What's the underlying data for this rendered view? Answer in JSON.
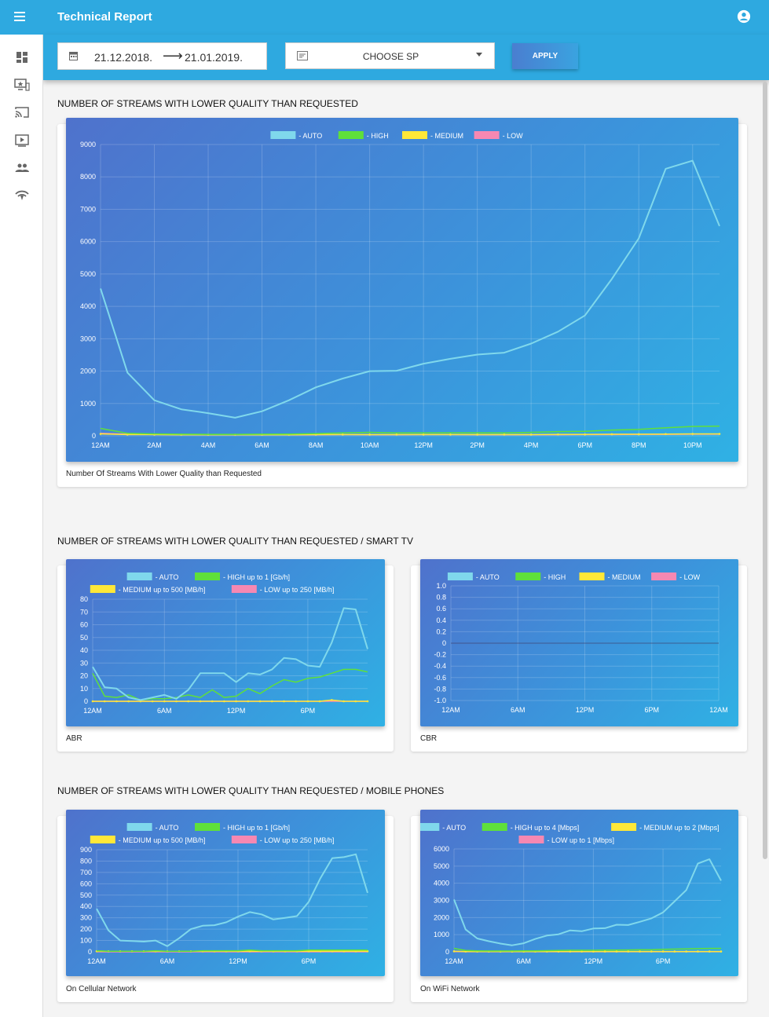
{
  "app": {
    "title": "Technical Report"
  },
  "filters": {
    "date_from": "21.12.2018.",
    "date_to": "21.01.2019.",
    "sp_label": "CHOOSE SP",
    "apply_label": "APPLY"
  },
  "sidebar": {
    "items": [
      {
        "icon": "dashboard-icon"
      },
      {
        "icon": "monitor-star-icon"
      },
      {
        "icon": "cast-icon"
      },
      {
        "icon": "play-screen-icon"
      },
      {
        "icon": "users-icon"
      },
      {
        "icon": "wifi-signal-icon"
      }
    ]
  },
  "sections": {
    "s1_title": "NUMBER OF STREAMS WITH LOWER QUALITY THAN REQUESTED",
    "s2_title": "NUMBER OF STREAMS WITH LOWER QUALITY THAN REQUESTED / SMART TV",
    "s3_title": "NUMBER OF STREAMS WITH LOWER QUALITY THAN REQUESTED / MOBILE PHONES"
  },
  "colors": {
    "auto": "#7fd8ec",
    "high": "#5fe03a",
    "medium": "#ffe838",
    "low": "#f688b2"
  },
  "chart_data": [
    {
      "id": "main",
      "type": "line",
      "caption": "Number Of Streams With Lower Quality than Requested",
      "ylim": [
        0,
        9000
      ],
      "yticks": [
        0,
        1000,
        2000,
        3000,
        4000,
        5000,
        6000,
        7000,
        8000,
        9000
      ],
      "xlim": [
        0,
        23
      ],
      "xticks": [
        {
          "x": 0,
          "label": "12AM"
        },
        {
          "x": 2,
          "label": "2AM"
        },
        {
          "x": 4,
          "label": "4AM"
        },
        {
          "x": 6,
          "label": "6AM"
        },
        {
          "x": 8,
          "label": "8AM"
        },
        {
          "x": 10,
          "label": "10AM"
        },
        {
          "x": 12,
          "label": "12PM"
        },
        {
          "x": 14,
          "label": "2PM"
        },
        {
          "x": 16,
          "label": "4PM"
        },
        {
          "x": 18,
          "label": "6PM"
        },
        {
          "x": 20,
          "label": "8PM"
        },
        {
          "x": 22,
          "label": "10PM"
        }
      ],
      "legend_rows": [
        [
          "auto",
          "high",
          "medium",
          "low"
        ]
      ],
      "series": [
        {
          "key": "auto",
          "name": "-  AUTO",
          "values": [
            4550,
            1950,
            1100,
            820,
            700,
            560,
            760,
            1100,
            1500,
            1770,
            2000,
            2010,
            2230,
            2380,
            2510,
            2570,
            2850,
            3220,
            3720,
            4850,
            6100,
            8250,
            8500,
            6480
          ]
        },
        {
          "key": "high",
          "name": "- HIGH",
          "values": [
            230,
            80,
            60,
            50,
            45,
            45,
            50,
            55,
            70,
            90,
            110,
            90,
            90,
            95,
            95,
            90,
            110,
            130,
            140,
            180,
            200,
            250,
            290,
            300
          ]
        },
        {
          "key": "medium",
          "name": "- MEDIUM",
          "values": [
            60,
            40,
            40,
            35,
            35,
            35,
            35,
            35,
            40,
            40,
            40,
            40,
            40,
            40,
            40,
            40,
            40,
            45,
            45,
            50,
            50,
            55,
            60,
            60
          ]
        },
        {
          "key": "low",
          "name": "- LOW",
          "values": [
            80,
            50,
            40,
            35,
            30,
            30,
            30,
            30,
            35,
            40,
            35,
            35,
            40,
            40,
            35,
            35,
            35,
            35,
            40,
            40,
            45,
            45,
            50,
            50
          ]
        }
      ]
    },
    {
      "id": "abr",
      "type": "line",
      "caption": "ABR",
      "ylim": [
        0,
        80
      ],
      "yticks": [
        0,
        10,
        20,
        30,
        40,
        50,
        60,
        70,
        80
      ],
      "xlim": [
        0,
        23
      ],
      "xticks": [
        {
          "x": 0,
          "label": "12AM"
        },
        {
          "x": 6,
          "label": "6AM"
        },
        {
          "x": 12,
          "label": "12PM"
        },
        {
          "x": 18,
          "label": "6PM"
        }
      ],
      "legend_rows": [
        [
          "auto",
          "high"
        ],
        [
          "medium",
          "low"
        ]
      ],
      "series": [
        {
          "key": "auto",
          "name": "-  AUTO",
          "values": [
            27,
            11,
            10,
            3,
            1,
            3,
            5,
            2,
            9,
            22,
            22,
            22,
            15,
            22,
            21,
            25,
            34,
            33,
            28,
            27,
            46,
            73,
            72,
            41
          ]
        },
        {
          "key": "high",
          "name": "- HIGH  up to 1 [Gb/h]",
          "values": [
            22,
            4,
            3,
            5,
            1,
            2,
            2,
            3,
            5,
            3,
            9,
            3,
            4,
            10,
            6,
            12,
            17,
            15,
            18,
            19,
            22,
            25,
            25,
            23
          ]
        },
        {
          "key": "medium",
          "name": "- MEDIUM up to 500 [MB/h]",
          "values": [
            0,
            0,
            0,
            0,
            0,
            0,
            0,
            0,
            0,
            0,
            0,
            0,
            0,
            0,
            0,
            0,
            0,
            0,
            0,
            0,
            1,
            0,
            0,
            0
          ]
        },
        {
          "key": "low",
          "name": "- LOW up to 250 [MB/h]",
          "values": [
            0,
            0,
            0,
            0,
            0,
            0,
            0,
            0,
            0,
            0,
            0,
            0,
            0,
            0,
            0,
            0,
            0,
            0,
            0,
            0,
            0,
            0,
            0,
            0
          ]
        }
      ]
    },
    {
      "id": "cbr",
      "type": "line",
      "caption": "CBR",
      "ylim": [
        -1.0,
        1.0
      ],
      "yticks": [
        -1.0,
        -0.8,
        -0.6,
        -0.4,
        -0.2,
        0,
        0.2,
        0.4,
        0.6,
        0.8,
        1.0
      ],
      "ytick_labels": [
        "-1.0",
        "-0.8",
        "-0.6",
        "-0.4",
        "-0.2",
        "0",
        "0.2",
        "0.4",
        "0.6",
        "0.8",
        "1.0"
      ],
      "xlim": [
        0,
        24
      ],
      "xticks": [
        {
          "x": 0,
          "label": "12AM"
        },
        {
          "x": 6,
          "label": "6AM"
        },
        {
          "x": 12,
          "label": "12PM"
        },
        {
          "x": 18,
          "label": "6PM"
        },
        {
          "x": 24,
          "label": "12AM"
        }
      ],
      "legend_rows": [
        [
          "auto",
          "high",
          "medium",
          "low"
        ]
      ],
      "zero_line": true,
      "series": [
        {
          "key": "auto",
          "name": "-  AUTO",
          "values": []
        },
        {
          "key": "high",
          "name": "- HIGH",
          "values": []
        },
        {
          "key": "medium",
          "name": "- MEDIUM",
          "values": []
        },
        {
          "key": "low",
          "name": "- LOW",
          "values": []
        }
      ]
    },
    {
      "id": "cellular",
      "type": "line",
      "caption": "On Cellular Network",
      "ylim": [
        0,
        900
      ],
      "yticks": [
        0,
        100,
        200,
        300,
        400,
        500,
        600,
        700,
        800,
        900
      ],
      "xlim": [
        0,
        23
      ],
      "xticks": [
        {
          "x": 0,
          "label": "12AM"
        },
        {
          "x": 6,
          "label": "6AM"
        },
        {
          "x": 12,
          "label": "12PM"
        },
        {
          "x": 18,
          "label": "6PM"
        }
      ],
      "legend_rows": [
        [
          "auto",
          "high"
        ],
        [
          "medium",
          "low"
        ]
      ],
      "series": [
        {
          "key": "auto",
          "name": "-  AUTO",
          "values": [
            380,
            190,
            100,
            95,
            90,
            100,
            50,
            120,
            200,
            230,
            235,
            260,
            310,
            350,
            330,
            285,
            300,
            315,
            440,
            650,
            825,
            835,
            860,
            520
          ]
        },
        {
          "key": "high",
          "name": "- HIGH  up to 1 [Gb/h]",
          "values": [
            10,
            5,
            5,
            5,
            5,
            10,
            5,
            5,
            5,
            10,
            10,
            10,
            10,
            15,
            10,
            10,
            10,
            10,
            15,
            15,
            15,
            15,
            15,
            15
          ]
        },
        {
          "key": "medium",
          "name": "- MEDIUM up to 500 [MB/h]",
          "values": [
            5,
            5,
            5,
            5,
            5,
            5,
            5,
            5,
            5,
            5,
            5,
            5,
            5,
            5,
            5,
            5,
            5,
            5,
            5,
            5,
            5,
            5,
            5,
            5
          ]
        },
        {
          "key": "low",
          "name": "- LOW up to 250 [MB/h]",
          "values": [
            0,
            0,
            0,
            0,
            0,
            0,
            0,
            0,
            0,
            0,
            0,
            0,
            0,
            0,
            0,
            0,
            0,
            0,
            0,
            0,
            0,
            0,
            0,
            0
          ]
        }
      ]
    },
    {
      "id": "wifi",
      "type": "line",
      "caption": "On WiFi Network",
      "ylim": [
        0,
        6000
      ],
      "yticks": [
        0,
        1000,
        2000,
        3000,
        4000,
        5000,
        6000
      ],
      "xlim": [
        0,
        23
      ],
      "xticks": [
        {
          "x": 0,
          "label": "12AM"
        },
        {
          "x": 6,
          "label": "6AM"
        },
        {
          "x": 12,
          "label": "12PM"
        },
        {
          "x": 18,
          "label": "6PM"
        }
      ],
      "legend_rows": [
        [
          "auto",
          "high",
          "medium"
        ],
        [
          "low"
        ]
      ],
      "series": [
        {
          "key": "auto",
          "name": "-  AUTO",
          "values": [
            3050,
            1300,
            780,
            620,
            480,
            380,
            500,
            750,
            950,
            1020,
            1250,
            1200,
            1360,
            1380,
            1580,
            1560,
            1750,
            1950,
            2300,
            2950,
            3600,
            5150,
            5400,
            4150
          ]
        },
        {
          "key": "high",
          "name": "- HIGH  up to 4 [Mbps]",
          "values": [
            200,
            80,
            60,
            50,
            50,
            50,
            60,
            60,
            70,
            80,
            90,
            90,
            90,
            100,
            100,
            110,
            120,
            120,
            140,
            160,
            170,
            190,
            200,
            200
          ]
        },
        {
          "key": "medium",
          "name": "- MEDIUM up to 2 [Mbps]",
          "values": [
            30,
            20,
            20,
            20,
            20,
            20,
            20,
            20,
            20,
            20,
            20,
            20,
            20,
            20,
            20,
            20,
            20,
            20,
            20,
            20,
            20,
            20,
            20,
            20
          ]
        },
        {
          "key": "low",
          "name": "- LOW up to 1 [Mbps]",
          "values": [
            10,
            5,
            5,
            5,
            5,
            5,
            5,
            5,
            5,
            5,
            5,
            5,
            5,
            5,
            5,
            5,
            5,
            5,
            5,
            5,
            5,
            5,
            5,
            5
          ]
        }
      ]
    }
  ]
}
